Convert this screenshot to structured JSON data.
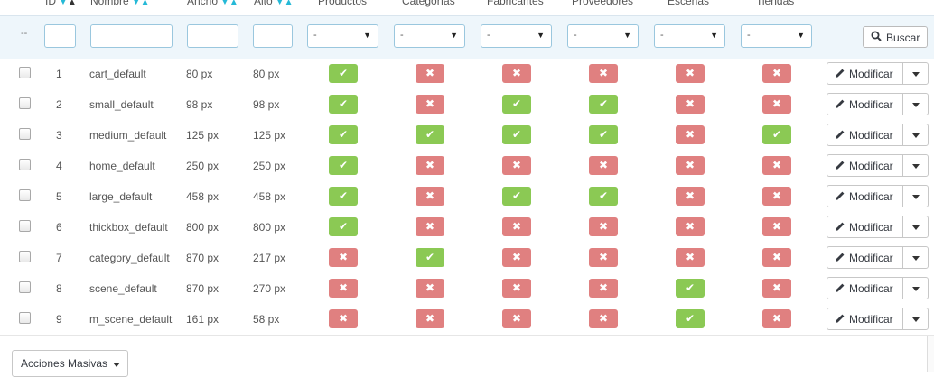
{
  "columns": {
    "id": "ID",
    "nombre": "Nombre",
    "ancho": "Ancho",
    "alto": "Alto",
    "productos": "Productos",
    "categorias": "Categorías",
    "fabricantes": "Fabricantes",
    "proveedores": "Proveedores",
    "escenas": "Escenas",
    "tiendas": "Tiendas"
  },
  "filters": {
    "dash": "--",
    "select_value": "-",
    "search_label": "Buscar"
  },
  "rows": [
    {
      "id": "1",
      "name": "cart_default",
      "width": "80 px",
      "height": "80 px",
      "flags": [
        true,
        false,
        false,
        false,
        false,
        false
      ]
    },
    {
      "id": "2",
      "name": "small_default",
      "width": "98 px",
      "height": "98 px",
      "flags": [
        true,
        false,
        true,
        true,
        false,
        false
      ]
    },
    {
      "id": "3",
      "name": "medium_default",
      "width": "125 px",
      "height": "125 px",
      "flags": [
        true,
        true,
        true,
        true,
        false,
        true
      ]
    },
    {
      "id": "4",
      "name": "home_default",
      "width": "250 px",
      "height": "250 px",
      "flags": [
        true,
        false,
        false,
        false,
        false,
        false
      ]
    },
    {
      "id": "5",
      "name": "large_default",
      "width": "458 px",
      "height": "458 px",
      "flags": [
        true,
        false,
        true,
        true,
        false,
        false
      ]
    },
    {
      "id": "6",
      "name": "thickbox_default",
      "width": "800 px",
      "height": "800 px",
      "flags": [
        true,
        false,
        false,
        false,
        false,
        false
      ]
    },
    {
      "id": "7",
      "name": "category_default",
      "width": "870 px",
      "height": "217 px",
      "flags": [
        false,
        true,
        false,
        false,
        false,
        false
      ]
    },
    {
      "id": "8",
      "name": "scene_default",
      "width": "870 px",
      "height": "270 px",
      "flags": [
        false,
        false,
        false,
        false,
        true,
        false
      ]
    },
    {
      "id": "9",
      "name": "m_scene_default",
      "width": "161 px",
      "height": "58 px",
      "flags": [
        false,
        false,
        false,
        false,
        true,
        false
      ]
    }
  ],
  "row_action": {
    "edit_label": "Modificar"
  },
  "bulk": {
    "label": "Acciones Masivas"
  },
  "colors": {
    "on": "#8bc954",
    "off": "#e08080",
    "accent": "#25b9d7"
  }
}
